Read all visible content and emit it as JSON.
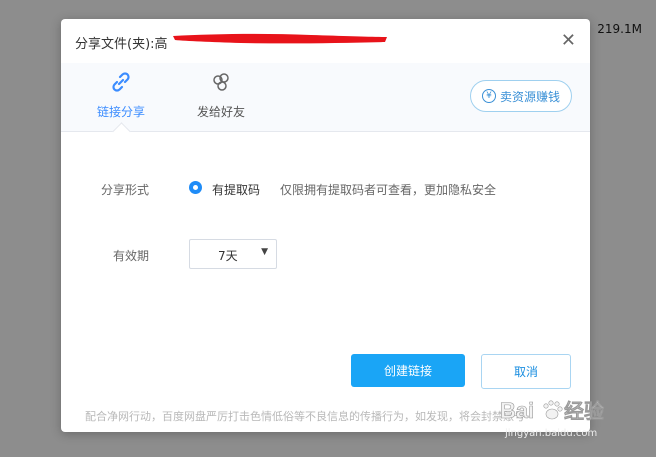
{
  "background": {
    "size_text": "219.1M"
  },
  "dialog": {
    "title_prefix": "分享文件(夹):",
    "title_visible_fragment": "高",
    "close_label": "✕",
    "tabs": [
      {
        "label": "链接分享",
        "icon": "link-icon",
        "active": true
      },
      {
        "label": "发给好友",
        "icon": "friends-icon",
        "active": false
      }
    ],
    "sell_button": {
      "icon": "yen-icon",
      "icon_glyph": "¥",
      "label": "卖资源赚钱"
    },
    "share_form": {
      "label": "分享形式",
      "option_label": "有提取码",
      "option_description": "仅限拥有提取码者可查看，更加隐私安全"
    },
    "validity": {
      "label": "有效期",
      "selected": "7天",
      "caret": "▼"
    },
    "buttons": {
      "create": "创建链接",
      "cancel": "取消"
    },
    "notice": "配合净网行动，百度网盘严厉打击色情低俗等不良信息的传播行为，如发现，将会封禁账号"
  },
  "watermark": {
    "logo_text": "Bai",
    "logo_text2": "经验",
    "url": "jingyan.baidu.com"
  },
  "colors": {
    "accent": "#1aa5f6",
    "link_blue": "#3b8cff",
    "redaction": "#e8131a",
    "overlay": "#8d8d8d"
  }
}
